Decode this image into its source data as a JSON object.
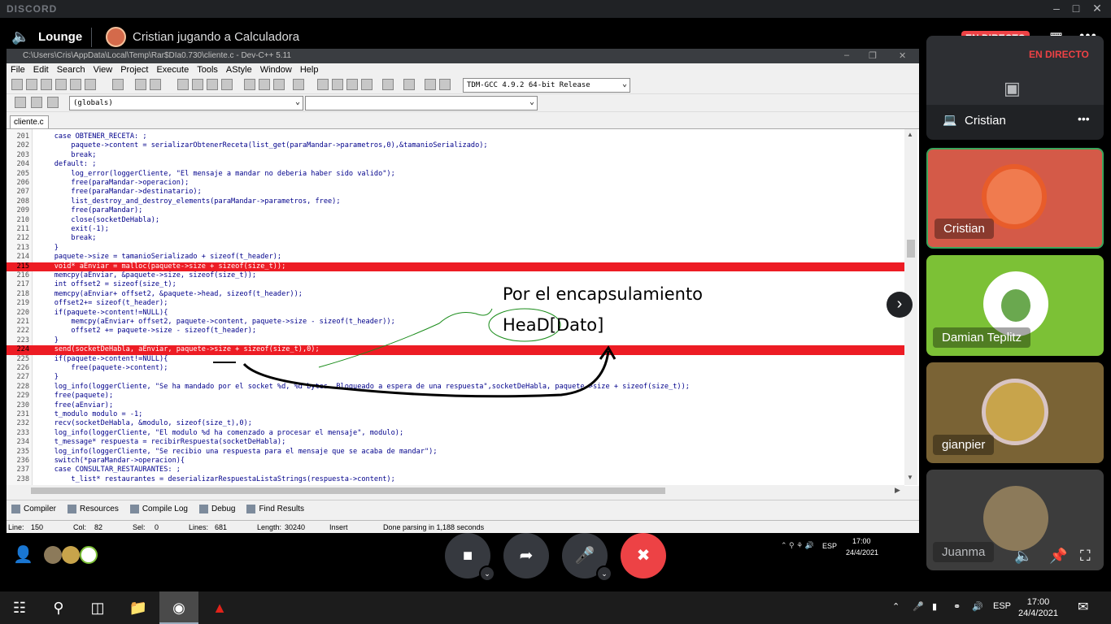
{
  "discord": {
    "brand": "DISCORD",
    "channel": "Lounge",
    "stream_title": "Cristian jugando a Calculadora",
    "live_badge": "EN DIRECTO",
    "stream_preview_label": "Cristian",
    "stream_preview_live": "EN DIRECTO"
  },
  "ide": {
    "window_title": "C:\\Users\\Cris\\AppData\\Local\\Temp\\Rar$DIa0.730\\cliente.c - Dev-C++ 5.11",
    "menu": [
      "File",
      "Edit",
      "Search",
      "View",
      "Project",
      "Execute",
      "Tools",
      "AStyle",
      "Window",
      "Help"
    ],
    "compiler_select": "TDM-GCC 4.9.2 64-bit Release",
    "scope_select": "(globals)",
    "file_tab": "cliente.c",
    "code": [
      {
        "n": "201",
        "t": "    case OBTENER_RECETA: ;"
      },
      {
        "n": "202",
        "t": "        paquete->content = serializarObtenerReceta(list_get(paraMandar->parametros,0),&tamanioSerializado);"
      },
      {
        "n": "203",
        "t": "        break;"
      },
      {
        "n": "204",
        "t": "    default: ;"
      },
      {
        "n": "205",
        "t": "        log_error(loggerCliente, \"El mensaje a mandar no deberia haber sido valido\");"
      },
      {
        "n": "206",
        "t": "        free(paraMandar->operacion);"
      },
      {
        "n": "207",
        "t": "        free(paraMandar->destinatario);"
      },
      {
        "n": "208",
        "t": "        list_destroy_and_destroy_elements(paraMandar->parametros, free);"
      },
      {
        "n": "209",
        "t": "        free(paraMandar);"
      },
      {
        "n": "210",
        "t": "        close(socketDeHabla);"
      },
      {
        "n": "211",
        "t": "        exit(-1);"
      },
      {
        "n": "212",
        "t": "        break;"
      },
      {
        "n": "213",
        "t": "    }"
      },
      {
        "n": "214",
        "t": "    paquete->size = tamanioSerializado + sizeof(t_header);"
      },
      {
        "n": "215",
        "t": "    void* aEnviar = malloc(paquete->size + sizeof(size_t));"
      },
      {
        "n": "216",
        "t": "    memcpy(aEnviar, &paquete->size, sizeof(size_t));"
      },
      {
        "n": "217",
        "t": "    int offset2 = sizeof(size_t);"
      },
      {
        "n": "218",
        "t": "    memcpy(aEnviar+ offset2, &paquete->head, sizeof(t_header));"
      },
      {
        "n": "219",
        "t": "    offset2+= sizeof(t_header);"
      },
      {
        "n": "220",
        "t": "    if(paquete->content!=NULL){"
      },
      {
        "n": "221",
        "t": "        memcpy(aEnviar+ offset2, paquete->content, paquete->size - sizeof(t_header));"
      },
      {
        "n": "222",
        "t": "        offset2 += paquete->size - sizeof(t_header);"
      },
      {
        "n": "223",
        "t": "    }"
      },
      {
        "n": "224",
        "t": "    send(socketDeHabla, aEnviar, paquete->size + sizeof(size_t),0);"
      },
      {
        "n": "225",
        "t": "    if(paquete->content!=NULL){"
      },
      {
        "n": "226",
        "t": "        free(paquete->content);"
      },
      {
        "n": "227",
        "t": "    }"
      },
      {
        "n": "228",
        "t": "    log_info(loggerCliente, \"Se ha mandado por el socket %d, %d bytes. Bloqueado a espera de una respuesta\",socketDeHabla, paquete->size + sizeof(size_t));"
      },
      {
        "n": "229",
        "t": "    free(paquete);"
      },
      {
        "n": "230",
        "t": "    free(aEnviar);"
      },
      {
        "n": "231",
        "t": "    t_modulo modulo = -1;"
      },
      {
        "n": "232",
        "t": "    recv(socketDeHabla, &modulo, sizeof(size_t),0);"
      },
      {
        "n": "233",
        "t": "    log_info(loggerCliente, \"El modulo %d ha comenzado a procesar el mensaje\", modulo);"
      },
      {
        "n": "234",
        "t": "    t_message* respuesta = recibirRespuesta(socketDeHabla);"
      },
      {
        "n": "235",
        "t": "    log_info(loggerCliente, \"Se recibio una respuesta para el mensaje que se acaba de mandar\");"
      },
      {
        "n": "236",
        "t": "    switch(*paraMandar->operacion){"
      },
      {
        "n": "237",
        "t": "    case CONSULTAR_RESTAURANTES: ;"
      },
      {
        "n": "238",
        "t": "        t_list* restaurantes = deserializarRespuestaListaStrings(respuesta->content);"
      }
    ],
    "highlighted_lines": [
      "215",
      "224"
    ],
    "bottom_tabs": [
      "Compiler",
      "Resources",
      "Compile Log",
      "Debug",
      "Find Results"
    ],
    "status": {
      "line": "Line:",
      "line_v": "150",
      "col": "Col:",
      "col_v": "82",
      "sel": "Sel:",
      "sel_v": "0",
      "lines": "Lines:",
      "lines_v": "681",
      "length": "Length:",
      "length_v": "30240",
      "mode": "Insert",
      "msg": "Done parsing in 1,188 seconds"
    }
  },
  "annotation": {
    "line1": "Por el encapsulamiento",
    "line2": "HeaD[Dato]"
  },
  "participants": [
    {
      "name": "Cristian",
      "bg": "#d45a48"
    },
    {
      "name": "Damian Teplitz",
      "bg": "#7cc136"
    },
    {
      "name": "gianpier",
      "bg": "#7a6335"
    },
    {
      "name": "Juanma",
      "bg": "#3c3c3c"
    }
  ],
  "remote_taskbar": {
    "lang": "ESP",
    "time": "17:00",
    "date": "24/4/2021"
  },
  "taskbar": {
    "lang": "ESP",
    "time": "17:00",
    "date": "24/4/2021"
  },
  "colors": {
    "live": "#ed4245",
    "highlight": "#ed1c24",
    "cristian_tile": "#d45a48",
    "damian_tile": "#7cc136"
  }
}
